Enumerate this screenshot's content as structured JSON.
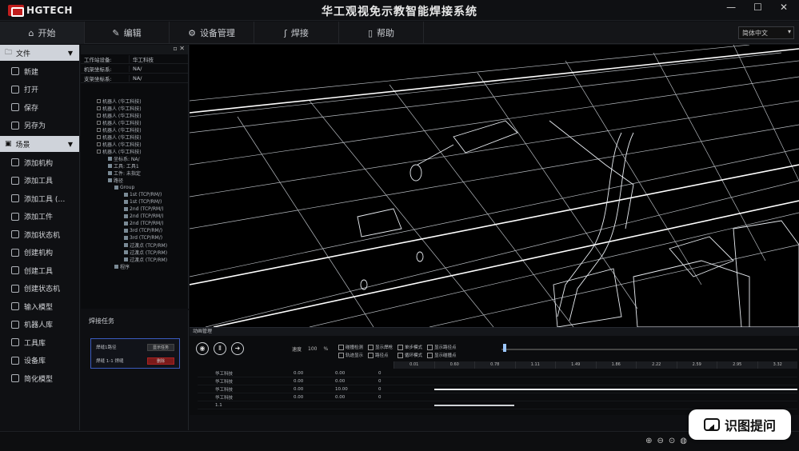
{
  "app": {
    "logo_text": "HGTECH",
    "title": "华工观视免示教智能焊接系统"
  },
  "window": {
    "minimize": "—",
    "maximize": "☐",
    "close": "✕"
  },
  "menubar": {
    "tabs": [
      {
        "label": "开始",
        "icon": "home-icon"
      },
      {
        "label": "编辑",
        "icon": "edit-icon"
      },
      {
        "label": "设备管理",
        "icon": "device-icon"
      },
      {
        "label": "焊接",
        "icon": "weld-icon"
      },
      {
        "label": "帮助",
        "icon": "help-icon"
      }
    ],
    "language": "简体中文"
  },
  "sidebar": {
    "group_file": "文件",
    "file_items": [
      "新建",
      "打开",
      "保存",
      "另存为"
    ],
    "group_scene": "场景",
    "scene_items": [
      "添加机构",
      "添加工具",
      "添加工具 (…",
      "添加工件",
      "添加状态机",
      "创建机构",
      "创建工具",
      "创建状态机",
      "输入模型",
      "机器人库",
      "工具库",
      "设备库",
      "简化模型"
    ]
  },
  "tree": {
    "props": [
      {
        "k": "工作站设备:",
        "v": "华工科技"
      },
      {
        "k": "机架坐标系:",
        "v": "NA/"
      },
      {
        "k": "支架坐标系:",
        "v": "NA/"
      }
    ],
    "nodes": [
      "机器人 (华工科技)",
      "机器人 (华工科技)",
      "机器人 (华工科技)",
      "机器人 (华工科技)",
      "机器人 (华工科技)",
      "机器人 (华工科技)",
      "机器人 (华工科技)",
      "机器人 (华工科技)",
      "坐标系: NA/",
      "工具: 工具1",
      "工件: 未指定",
      "路径",
      "Group",
      "1st (TCP/RM/)",
      "1st (TCP/RM/)",
      "2nd (TCP/RM/)",
      "2nd (TCP/RM/)",
      "2nd (TCP/RM/)",
      "3rd (TCP/RM/)",
      "3rd (TCP/RM/)",
      "过渡点 (TCP/RM)",
      "过渡点 (TCP/RM)",
      "过渡点 (TCP/RM)",
      "程序"
    ]
  },
  "tasks": {
    "title": "焊接任务",
    "row1_label": "焊缝1路径",
    "row1_btn": "显示任务",
    "row2_label": "焊缝 1-1 焊缝",
    "row2_btn": "删除"
  },
  "animation": {
    "title": "动画管理",
    "speed_label": "速度",
    "speed_value": "100",
    "speed_unit": "%",
    "options": [
      "碰撞检测",
      "显示焊枪",
      "单步模式",
      "显示路径点",
      "轨迹显示",
      "路径点",
      "循环模式",
      "显示碰撞点"
    ],
    "ticks": [
      "0.01",
      "0.60",
      "0.78",
      "1.11",
      "1.49",
      "1.86",
      "2.22",
      "2.59",
      "2.95",
      "3.32"
    ],
    "slider_position": 0.01,
    "tracks": [
      {
        "name": "华工科技",
        "a": "0.00",
        "b": "0.00",
        "c": "0",
        "bar": "none"
      },
      {
        "name": "华工科技",
        "a": "0.00",
        "b": "0.00",
        "c": "0",
        "bar": "none"
      },
      {
        "name": "华工科技",
        "a": "0.00",
        "b": "10.00",
        "c": "0",
        "bar": "on"
      },
      {
        "name": "华工科技",
        "a": "0.00",
        "b": "0.00",
        "c": "0",
        "bar": "none"
      },
      {
        "name": "1.1",
        "a": "",
        "b": "",
        "c": "",
        "bar": "half"
      }
    ]
  },
  "watermark": {
    "text": "识图提问"
  }
}
